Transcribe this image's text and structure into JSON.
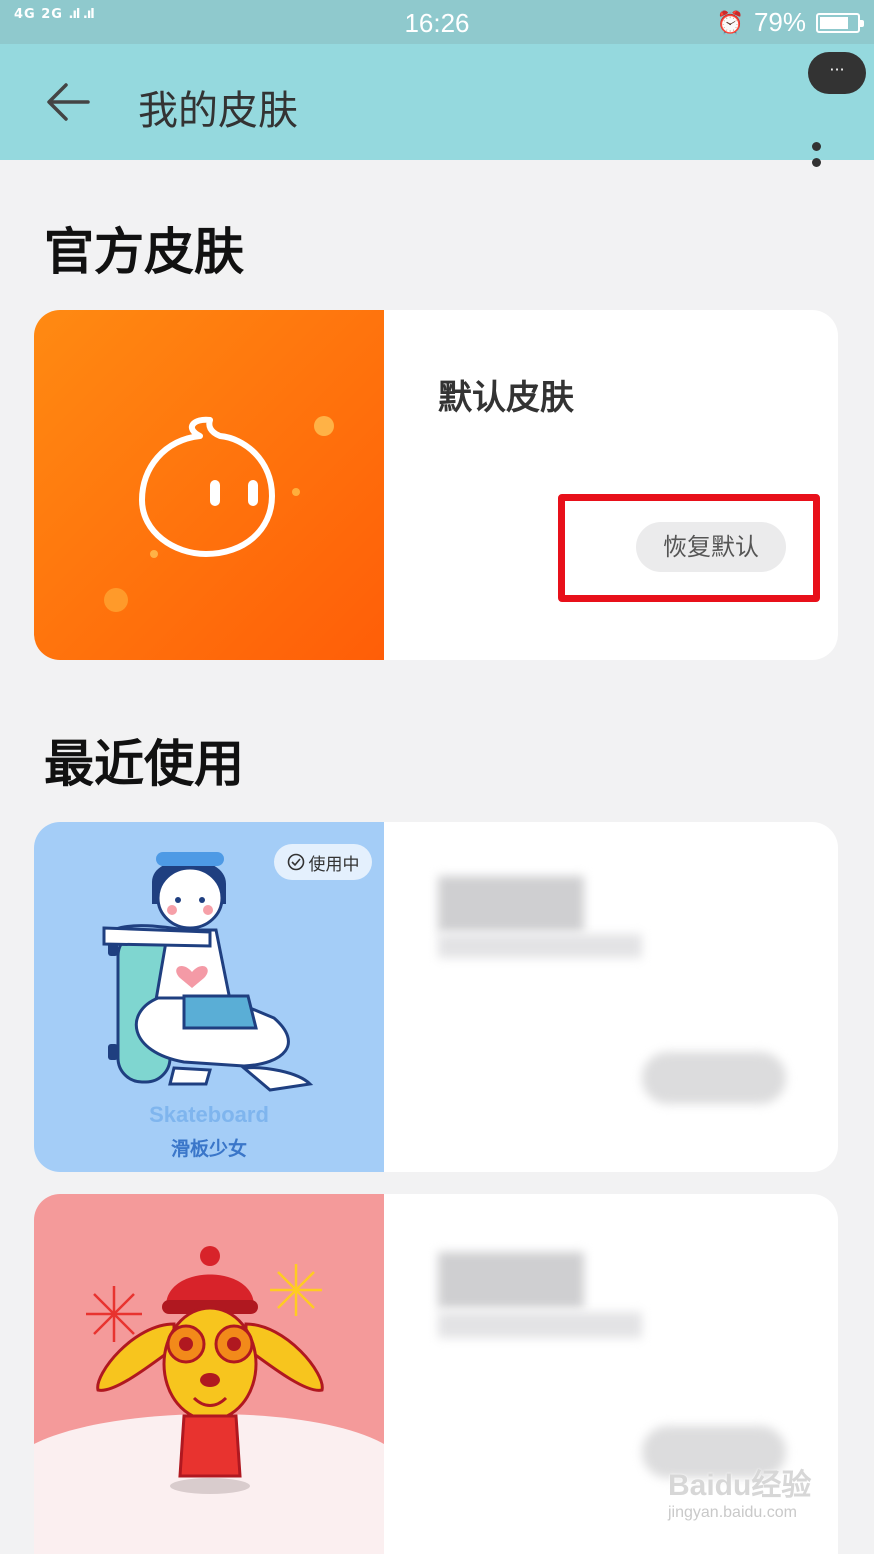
{
  "status_bar": {
    "network_label": "4G 2G",
    "time": "16:26",
    "battery_percent": "79%",
    "battery_level": 0.79
  },
  "app_bar": {
    "title": "我的皮肤",
    "more_label": "···"
  },
  "official_section": {
    "title": "官方皮肤",
    "default_skin": {
      "name": "默认皮肤",
      "restore_button": "恢复默认",
      "theme_color": "#ff7a12"
    }
  },
  "recent_section": {
    "title": "最近使用",
    "items": [
      {
        "badge": "使用中",
        "thumb_text_en": "Skateboard",
        "thumb_text_cn": "滑板少女",
        "theme_color": "#9fcbf5"
      },
      {
        "theme_color": "#f49a9a"
      }
    ]
  },
  "watermark": {
    "logo": "Baidu经验",
    "url": "jingyan.baidu.com"
  },
  "colors": {
    "app_bar": "#95d9de",
    "status_bar": "#8fc9cd",
    "highlight": "#e8101a"
  }
}
